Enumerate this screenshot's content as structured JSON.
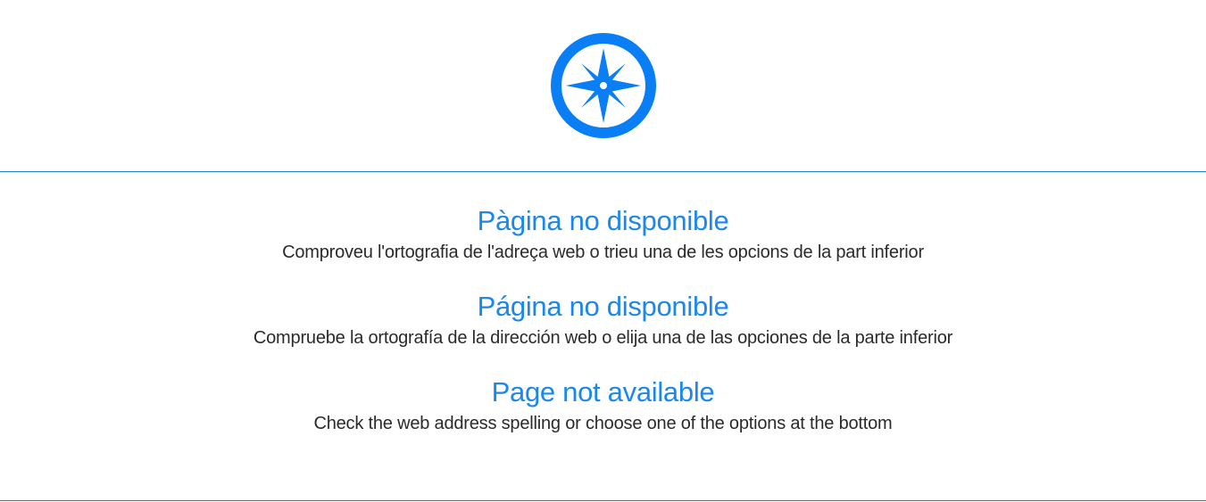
{
  "logo": {
    "icon": "compass-icon",
    "color": "#0a7ef5"
  },
  "colors": {
    "accent": "#1a87ec",
    "divider": "#1f7fd6",
    "text": "#2a2a2a"
  },
  "messages": [
    {
      "lang": "ca",
      "title": "Pàgina no disponible",
      "text": "Comproveu l'ortografia de l'adreça web o trieu una de les opcions de la part inferior"
    },
    {
      "lang": "es",
      "title": "Página no disponible",
      "text": "Compruebe la ortografía de la dirección web o elija una de las opciones de la parte inferior"
    },
    {
      "lang": "en",
      "title": "Page not available",
      "text": "Check the web address spelling or choose one of the options at the bottom"
    }
  ]
}
